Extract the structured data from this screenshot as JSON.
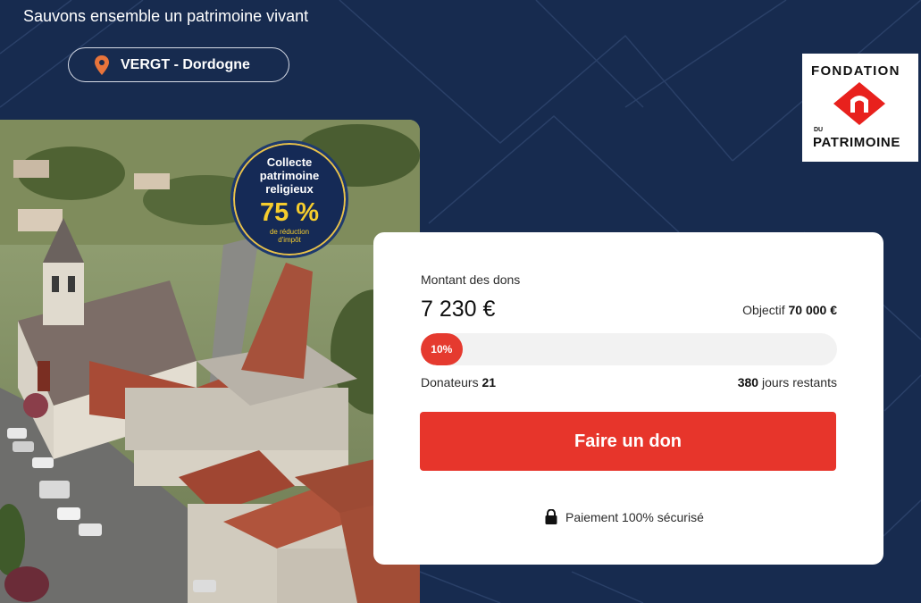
{
  "header": {
    "tagline": "Sauvons ensemble un patrimoine vivant",
    "location": "VERGT - Dordogne",
    "location_icon": "map-pin-icon"
  },
  "logo": {
    "line1": "FONDATION",
    "line2": "DU",
    "line3": "PATRIMOINE",
    "color": "#e8211d"
  },
  "badge": {
    "line1": "Collecte",
    "line2": "patrimoine",
    "line3": "religieux",
    "percent": "75 %",
    "sub1": "de réduction",
    "sub2": "d'impôt"
  },
  "donation": {
    "amount_label": "Montant des dons",
    "amount": "7 230 €",
    "goal_label": "Objectif",
    "goal_value": "70 000 €",
    "progress_label": "10%",
    "progress_fraction": 0.1,
    "donors_label": "Donateurs",
    "donors_count": "21",
    "days_count": "380",
    "days_label": "jours restants",
    "button_label": "Faire un don",
    "secure_label": "Paiement 100% sécurisé",
    "accent": "#e7352b"
  },
  "theme": {
    "background": "#172b4f"
  }
}
